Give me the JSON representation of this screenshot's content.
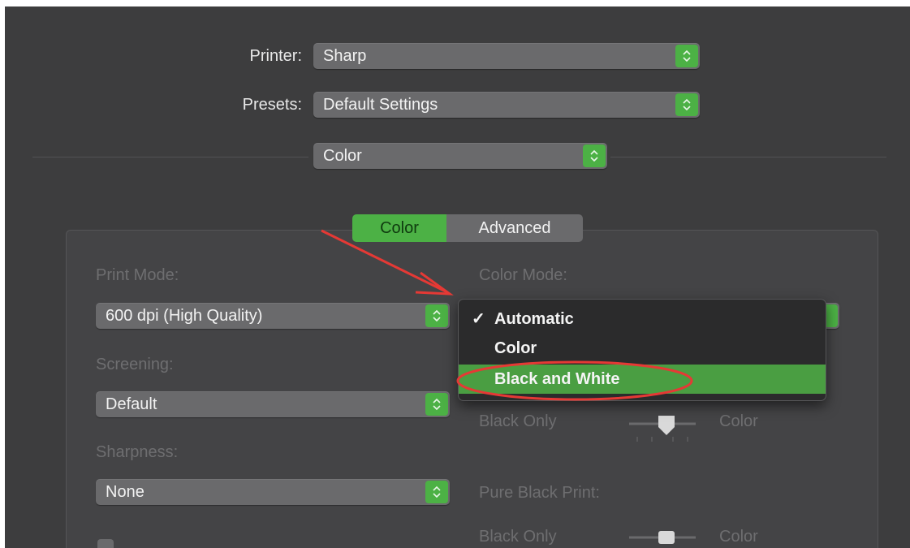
{
  "printer": {
    "label": "Printer:",
    "value": "Sharp"
  },
  "presets": {
    "label": "Presets:",
    "value": "Default Settings"
  },
  "section": {
    "value": "Color"
  },
  "tabs": [
    {
      "label": "Color",
      "selected": true
    },
    {
      "label": "Advanced",
      "selected": false
    }
  ],
  "print_mode": {
    "label": "Print Mode:",
    "value": "600 dpi (High Quality)"
  },
  "screening": {
    "label": "Screening:",
    "value": "Default"
  },
  "sharpness": {
    "label": "Sharpness:",
    "value": "None"
  },
  "color_mode": {
    "label": "Color Mode:",
    "options": [
      {
        "check": "✓",
        "label": "Automatic"
      },
      {
        "check": "",
        "label": "Color"
      },
      {
        "check": "",
        "label": "Black and White"
      }
    ]
  },
  "slider1": {
    "left_label": "Black Only",
    "right_label": "Color"
  },
  "pure_black": {
    "label": "Pure Black Print:",
    "left_label": "Black Only",
    "right_label": "Color"
  },
  "colors": {
    "accent": "#4cb145",
    "highlight": "#4a9e42",
    "annotation": "#e53935"
  }
}
